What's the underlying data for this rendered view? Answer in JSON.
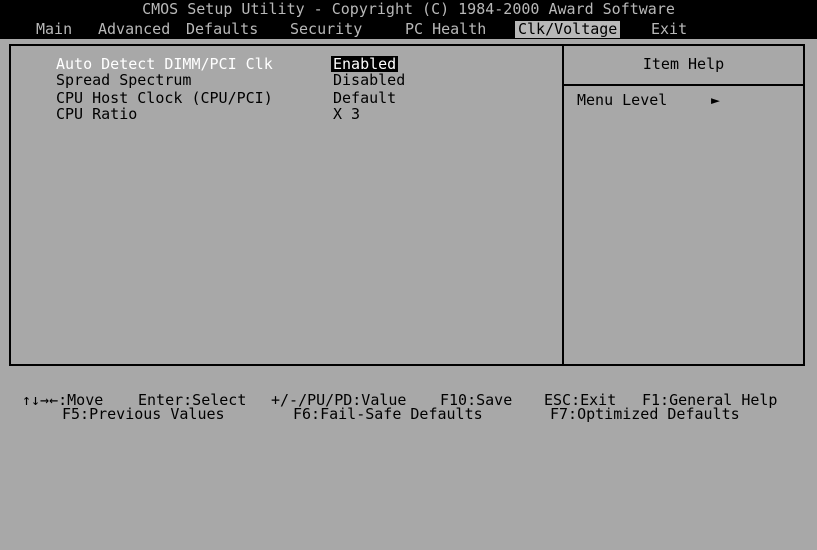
{
  "title": "CMOS Setup Utility - Copyright (C) 1984-2000 Award Software",
  "menu": [
    "Main",
    "Advanced",
    "Defaults",
    "Security",
    "PC Health",
    "Clk/Voltage",
    "Exit"
  ],
  "options": [
    {
      "label": "Auto Detect DIMM/PCI Clk",
      "value": "Enabled",
      "selected": true
    },
    {
      "label": "Spread Spectrum",
      "value": "Disabled"
    },
    {
      "label": "CPU Host Clock (CPU/PCI)",
      "value": "Default"
    },
    {
      "label": "CPU Ratio",
      "value": "X 3"
    }
  ],
  "help": {
    "title": "Item Help",
    "menu_level": "Menu Level",
    "arrow": "►"
  },
  "footer": {
    "row1": [
      "↑↓→←:Move",
      "Enter:Select",
      "+/-/PU/PD:Value",
      "F10:Save",
      "ESC:Exit",
      "F1:General Help"
    ],
    "row2": [
      "F5:Previous Values",
      "F6:Fail-Safe Defaults",
      "F7:Optimized Defaults"
    ]
  }
}
